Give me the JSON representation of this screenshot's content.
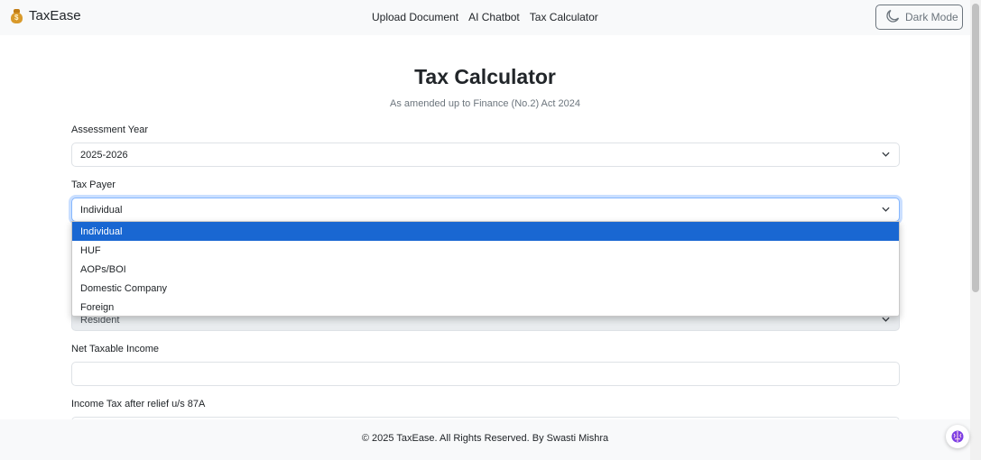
{
  "navbar": {
    "brand_name": "TaxEase",
    "brand_icon": "money-bag-icon",
    "links": [
      "Upload Document",
      "AI Chatbot",
      "Tax Calculator"
    ],
    "dark_mode_label": "Dark Mode",
    "dark_mode_icon": "moon-icon"
  },
  "page": {
    "title": "Tax Calculator",
    "subtitle": "As amended up to Finance (No.2) Act 2024"
  },
  "form": {
    "assessment_year": {
      "label": "Assessment Year",
      "value": "2025-2026"
    },
    "tax_payer": {
      "label": "Tax Payer",
      "value": "Individual",
      "options": [
        "Individual",
        "HUF",
        "AOPs/BOI",
        "Domestic Company",
        "Foreign"
      ],
      "selected_index": 0
    },
    "residential_status": {
      "value": "Resident"
    },
    "net_taxable_income": {
      "label": "Net Taxable Income",
      "value": ""
    },
    "income_tax_after_relief": {
      "label": "Income Tax after relief u/s 87A"
    }
  },
  "footer": {
    "text": "© 2025 TaxEase. All Rights Reserved. By Swasti Mishra"
  },
  "colors": {
    "accent_selected": "#1967d2",
    "focus_ring": "#86b7fe",
    "navbar_bg": "#f8f9fa",
    "muted_text": "#6c757d"
  }
}
